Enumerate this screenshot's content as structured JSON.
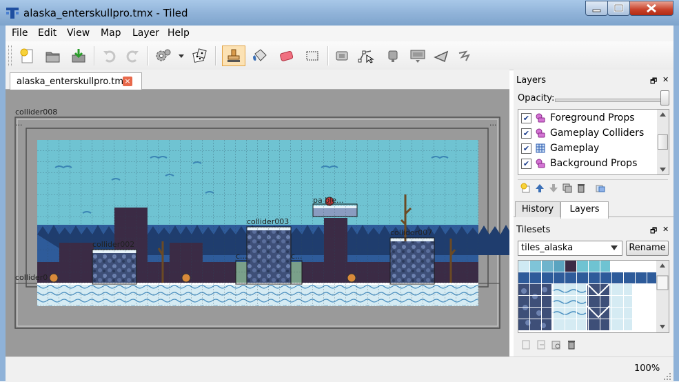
{
  "window": {
    "title": "alaska_enterskullpro.tmx - Tiled"
  },
  "menu": [
    "File",
    "Edit",
    "View",
    "Map",
    "Layer",
    "Help"
  ],
  "toolbar": {
    "icons": [
      "new-map-icon",
      "open-file-icon",
      "save-icon",
      "undo-icon",
      "redo-icon",
      "commands-icon",
      "command-dropdown-icon",
      "random-mode-icon",
      "stamp-brush-icon",
      "bucket-fill-icon",
      "eraser-icon",
      "rect-select-icon",
      "select-objects-icon",
      "edit-polygons-icon",
      "insert-rectangle-icon",
      "insert-image-icon",
      "insert-polygon-icon",
      "insert-polyline-icon"
    ]
  },
  "tab": {
    "label": "alaska_enterskullpro.tmx",
    "close": "×"
  },
  "map": {
    "object_labels": [
      "collider008",
      "...",
      "...",
      "collider002",
      "collider003",
      "pa ble...",
      "collider007",
      "c...",
      "c...",
      "collider0"
    ]
  },
  "layers_panel": {
    "title": "Layers",
    "float_icon": "🗗",
    "close_icon": "✕",
    "opacity_label": "Opacity:",
    "opacity_value": 1.0,
    "layers": [
      {
        "name": "Foreground Props",
        "checked": true,
        "type": "object"
      },
      {
        "name": "Gameplay Colliders",
        "checked": true,
        "type": "object"
      },
      {
        "name": "Gameplay",
        "checked": true,
        "type": "tile"
      },
      {
        "name": "Background Props",
        "checked": true,
        "type": "object"
      }
    ],
    "buttons": [
      "add-layer-icon",
      "raise-layer-icon",
      "lower-layer-icon",
      "duplicate-layer-icon",
      "delete-layer-icon",
      "layer-visibility-icon"
    ]
  },
  "dock_tabs": {
    "history": "History",
    "layers": "Layers",
    "active": "Layers"
  },
  "tilesets_panel": {
    "title": "Tilesets",
    "float_icon": "🗗",
    "close_icon": "✕",
    "selected": "tiles_alaska",
    "rename_label": "Rename",
    "buttons": [
      "new-tileset-icon",
      "import-tileset-icon",
      "edit-tileset-icon",
      "remove-tileset-icon"
    ]
  },
  "status": {
    "zoom": "100%"
  },
  "colors": {
    "sky": "#6fc3d2",
    "accent": "#3a6fb6",
    "ground_snow": "#d8ecf4"
  }
}
